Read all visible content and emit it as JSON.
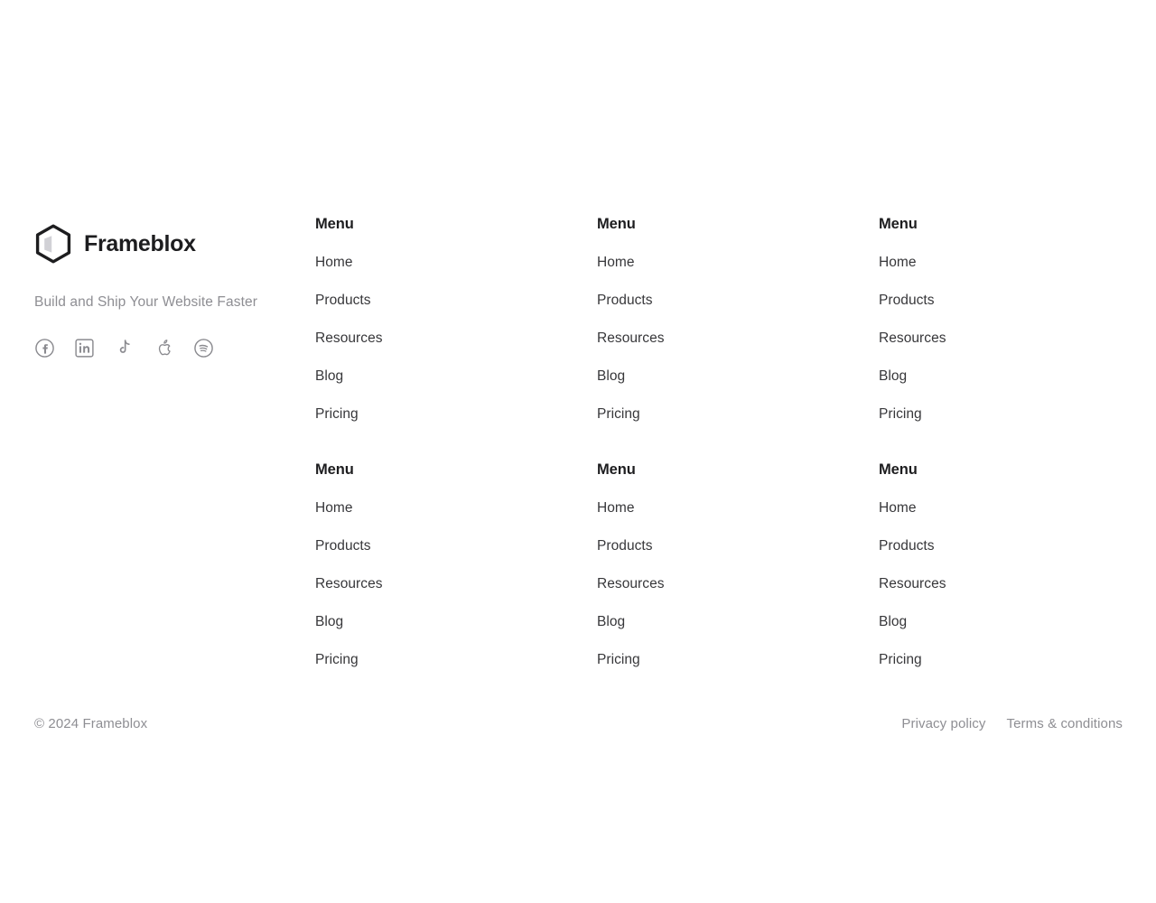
{
  "brand": {
    "name": "Frameblox",
    "tagline": "Build and Ship Your Website Faster",
    "logo_icon": "hexagon-cube-logo-icon",
    "logo_outline_color": "#1d1d1f",
    "logo_face_color": "#d1d1d6"
  },
  "social": {
    "items": [
      {
        "icon": "facebook-icon",
        "label": "Facebook"
      },
      {
        "icon": "linkedin-icon",
        "label": "LinkedIn"
      },
      {
        "icon": "tiktok-icon",
        "label": "TikTok"
      },
      {
        "icon": "apple-icon",
        "label": "Apple"
      },
      {
        "icon": "spotify-icon",
        "label": "Spotify"
      }
    ]
  },
  "menu_columns": [
    {
      "heading": "Menu",
      "links": [
        "Home",
        "Products",
        "Resources",
        "Blog",
        "Pricing"
      ]
    },
    {
      "heading": "Menu",
      "links": [
        "Home",
        "Products",
        "Resources",
        "Blog",
        "Pricing"
      ]
    },
    {
      "heading": "Menu",
      "links": [
        "Home",
        "Products",
        "Resources",
        "Blog",
        "Pricing"
      ]
    },
    {
      "heading": "Menu",
      "links": [
        "Home",
        "Products",
        "Resources",
        "Blog",
        "Pricing"
      ]
    },
    {
      "heading": "Menu",
      "links": [
        "Home",
        "Products",
        "Resources",
        "Blog",
        "Pricing"
      ]
    },
    {
      "heading": "Menu",
      "links": [
        "Home",
        "Products",
        "Resources",
        "Blog",
        "Pricing"
      ]
    }
  ],
  "bottom": {
    "copyright": "© 2024 Frameblox",
    "legal": [
      "Privacy policy",
      "Terms & conditions"
    ]
  },
  "colors": {
    "background": "#ffffff",
    "heading": "#1d1d1f",
    "link": "#37373a",
    "muted": "#8e8e93",
    "icon": "#8a8a8f"
  }
}
